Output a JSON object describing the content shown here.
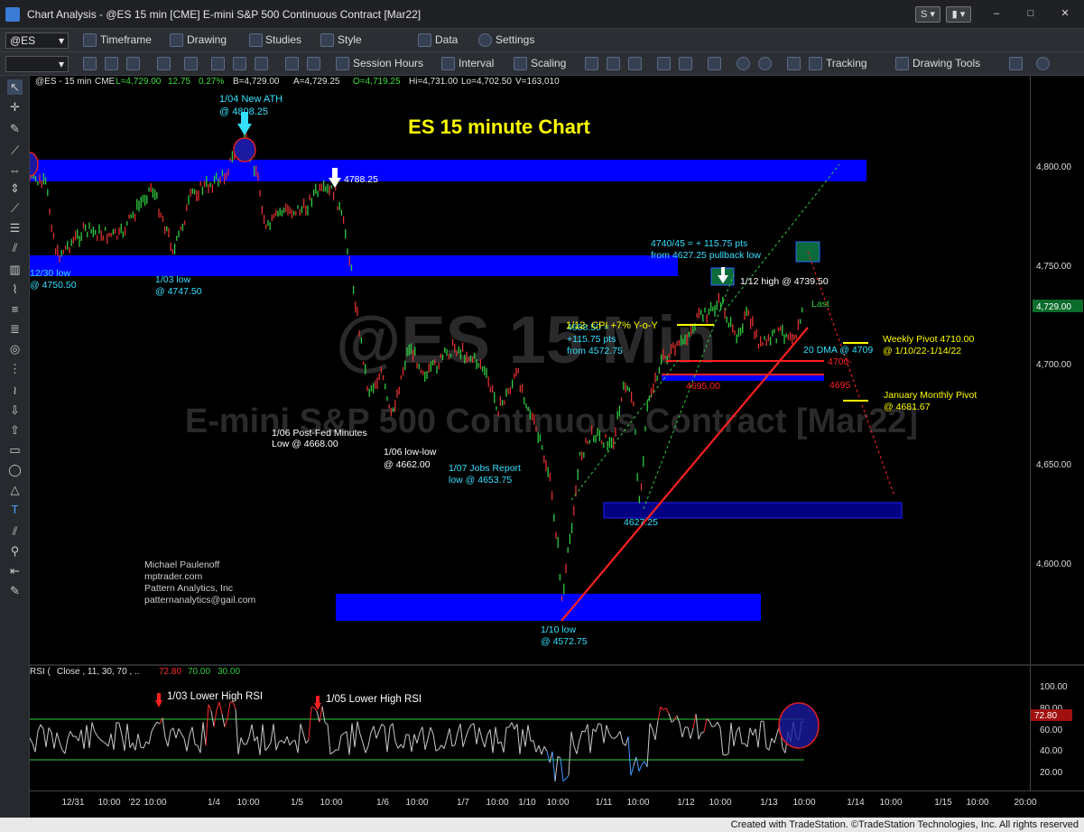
{
  "window": {
    "title": "Chart Analysis - @ES 15 min [CME] E-mini S&P 500 Continuous Contract [Mar22]",
    "min": "–",
    "max": "□",
    "close": "✕"
  },
  "toolbar1": {
    "symbol": "@ES",
    "items": [
      "Timeframe",
      "Drawing",
      "Studies",
      "Style",
      "Data",
      "Settings"
    ]
  },
  "toolbar2": {
    "items": [
      "Session Hours",
      "Interval",
      "Scaling",
      "Tracking",
      "Drawing Tools"
    ]
  },
  "header": {
    "symbol": "@ES - 15 min",
    "exchange": "CME",
    "last": "L=4,729.00",
    "chg": "12.75",
    "pct": "0.27%",
    "bid": "B=4,729.00",
    "ask": "A=4,729.25",
    "open": "O=4,719.25",
    "hi": "Hi=4,731.00",
    "lo": "Lo=4,702.50",
    "vol": "V=163,010"
  },
  "watermark": {
    "line1": "@ES 15 Min",
    "line2": "E-mini S&P 500 Continuous Contract [Mar22]"
  },
  "chart_title": "ES 15 minute Chart",
  "price_labels": [
    "4,800.00",
    "4,750.00",
    "4,700.00",
    "4,650.00",
    "4,600.00"
  ],
  "last_tag": "4,729.00",
  "rsi_labels": [
    "100.00",
    "80.00",
    "60.00",
    "40.00",
    "20.00"
  ],
  "rsi_tag": "72.80",
  "rsi_header": {
    "name": "RSI (",
    "params": "Close , 11, 30, 70 , ..",
    "v1": "72.80",
    "v2": "70.00",
    "v3": "30.00"
  },
  "time_labels": [
    "12/31",
    "10:00",
    "'22",
    "10:00",
    "1/4",
    "10:00",
    "1/5",
    "10:00",
    "1/6",
    "10:00",
    "1/7",
    "10:00",
    "1/10",
    "10:00",
    "1/11",
    "10:00",
    "1/12",
    "10:00",
    "1/13",
    "10:00",
    "1/14",
    "10:00",
    "1/15",
    "10:00",
    "20:00"
  ],
  "annotations": {
    "ath1": "1/04 New ATH",
    "ath2": "@ 4808.25",
    "h4788": "4788.25",
    "l1230a": "12/30 low",
    "l1230b": "@ 4750.50",
    "l103a": "1/03 low",
    "l103b": "@ 4747.50",
    "fed1": "1/06 Post-Fed Minutes",
    "fed2": "Low @ 4668.00",
    "l106a": "1/06 low-low",
    "l106b": "@ 4662.00",
    "jobs1": "1/07 Jobs Report",
    "jobs2": "low @ 4653.75",
    "l110a": "1/10 low",
    "l110b": "@ 4572.75",
    "l4627": "4627.25",
    "mv1": "4688.50 =",
    "mv2": "+115.75 pts",
    "mv3": "from 4572.75",
    "tgt1": "4740/45 = + 115.75 pts",
    "tgt2": "from 4627.25 pullback low",
    "h112": "1/12 high @ 4739.50",
    "cpi": "1/12- CPI +7% Y-o-Y",
    "last": "Last",
    "dma": "20 DMA @ 4709",
    "wp1": "Weekly Pivot 4710.00",
    "wp2": "@ 1/10/22-1/14/22",
    "mp1": "January Monthly Pivot",
    "mp2": "@ 4681.67",
    "l4700": "4700-",
    "l4695a": "4695.00",
    "l4695b": "4695",
    "author1": "Michael Paulenoff",
    "author2": "mptrader.com",
    "author3": "Pattern Analytics, Inc",
    "author4": "patternanalytics@gail.com",
    "rsi1": "1/03 Lower High RSI",
    "rsi2": "1/05 Lower High RSI"
  },
  "footer": "Created with TradeStation. ©TradeStation Technologies, Inc. All rights reserved"
}
